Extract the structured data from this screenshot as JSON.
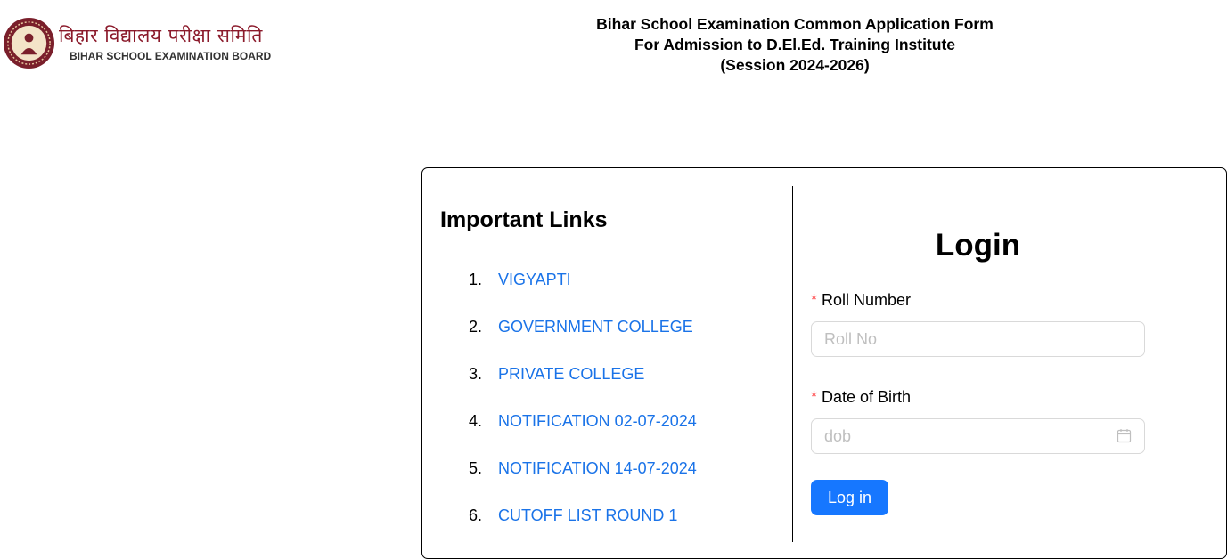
{
  "header": {
    "logo_hindi": "बिहार विद्यालय परीक्षा समिति",
    "logo_english": "BIHAR SCHOOL EXAMINATION BOARD",
    "title_line1": "Bihar School Examination Common Application Form",
    "title_line2": "For Admission to D.El.Ed. Training Institute",
    "title_line3": "(Session 2024-2026)"
  },
  "links": {
    "heading": "Important Links",
    "items": [
      {
        "num": "1.",
        "label": "VIGYAPTI"
      },
      {
        "num": "2.",
        "label": "GOVERNMENT COLLEGE"
      },
      {
        "num": "3.",
        "label": "PRIVATE COLLEGE"
      },
      {
        "num": "4.",
        "label": "NOTIFICATION 02-07-2024"
      },
      {
        "num": "5.",
        "label": "NOTIFICATION 14-07-2024"
      },
      {
        "num": "6.",
        "label": "CUTOFF LIST ROUND 1"
      }
    ]
  },
  "login": {
    "title": "Login",
    "roll_label": "Roll Number",
    "roll_placeholder": "Roll No",
    "roll_value": "",
    "dob_label": "Date of Birth",
    "dob_placeholder": "dob",
    "dob_value": "",
    "required_mark": "*",
    "submit_label": "Log in"
  },
  "icons": {
    "calendar": "calendar-icon",
    "emblem": "bseb-emblem-icon"
  },
  "colors": {
    "link": "#1a73e8",
    "primary_button": "#1677ff",
    "required": "#ff4d4f",
    "logo_text": "#8b1a2b"
  }
}
